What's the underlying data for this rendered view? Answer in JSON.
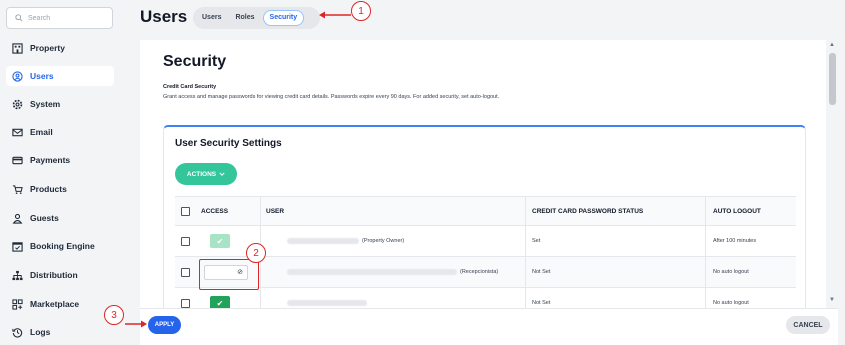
{
  "sidebar": {
    "search_placeholder": "Search",
    "items": [
      {
        "label": "Property",
        "icon": "building-icon"
      },
      {
        "label": "Users",
        "icon": "user-circle-icon"
      },
      {
        "label": "System",
        "icon": "gear-icon"
      },
      {
        "label": "Email",
        "icon": "envelope-icon"
      },
      {
        "label": "Payments",
        "icon": "credit-card-icon"
      },
      {
        "label": "Products",
        "icon": "cart-icon"
      },
      {
        "label": "Guests",
        "icon": "person-icon"
      },
      {
        "label": "Booking Engine",
        "icon": "calendar-check-icon"
      },
      {
        "label": "Distribution",
        "icon": "sitemap-icon"
      },
      {
        "label": "Marketplace",
        "icon": "grid-plus-icon"
      },
      {
        "label": "Logs",
        "icon": "history-icon"
      }
    ],
    "active": "Users"
  },
  "header": {
    "title": "Users",
    "tabs": [
      "Users",
      "Roles",
      "Security"
    ],
    "active_tab": "Security"
  },
  "annotations": [
    "1",
    "2",
    "3"
  ],
  "section": {
    "title": "Security",
    "subtitle": "Credit Card Security",
    "description": "Grant access and manage passwords for viewing credit card details. Passwords expire every 90 days. For added security, set auto-logout."
  },
  "card": {
    "title": "User Security Settings",
    "actions_label": "ACTIONS",
    "columns": [
      "ACCESS",
      "USER",
      "CREDIT CARD PASSWORD STATUS",
      "AUTO LOGOUT"
    ],
    "rows": [
      {
        "access": "granted-light",
        "user_suffix": "(Property Owner)",
        "status": "Set",
        "auto_logout": "After 100 minutes"
      },
      {
        "access": "denied",
        "user_suffix": "(Recepcionista)",
        "status": "Not Set",
        "auto_logout": "No auto logout"
      },
      {
        "access": "granted",
        "user_suffix": "",
        "status": "Not Set",
        "auto_logout": "No auto logout"
      }
    ]
  },
  "footer": {
    "apply_label": "APPLY",
    "cancel_label": "CANCEL"
  },
  "colors": {
    "primary": "#2563eb",
    "actions": "#34c59a",
    "access_granted": "#22a35a",
    "access_light": "#a7e3c4",
    "annotation": "#dc2626"
  }
}
